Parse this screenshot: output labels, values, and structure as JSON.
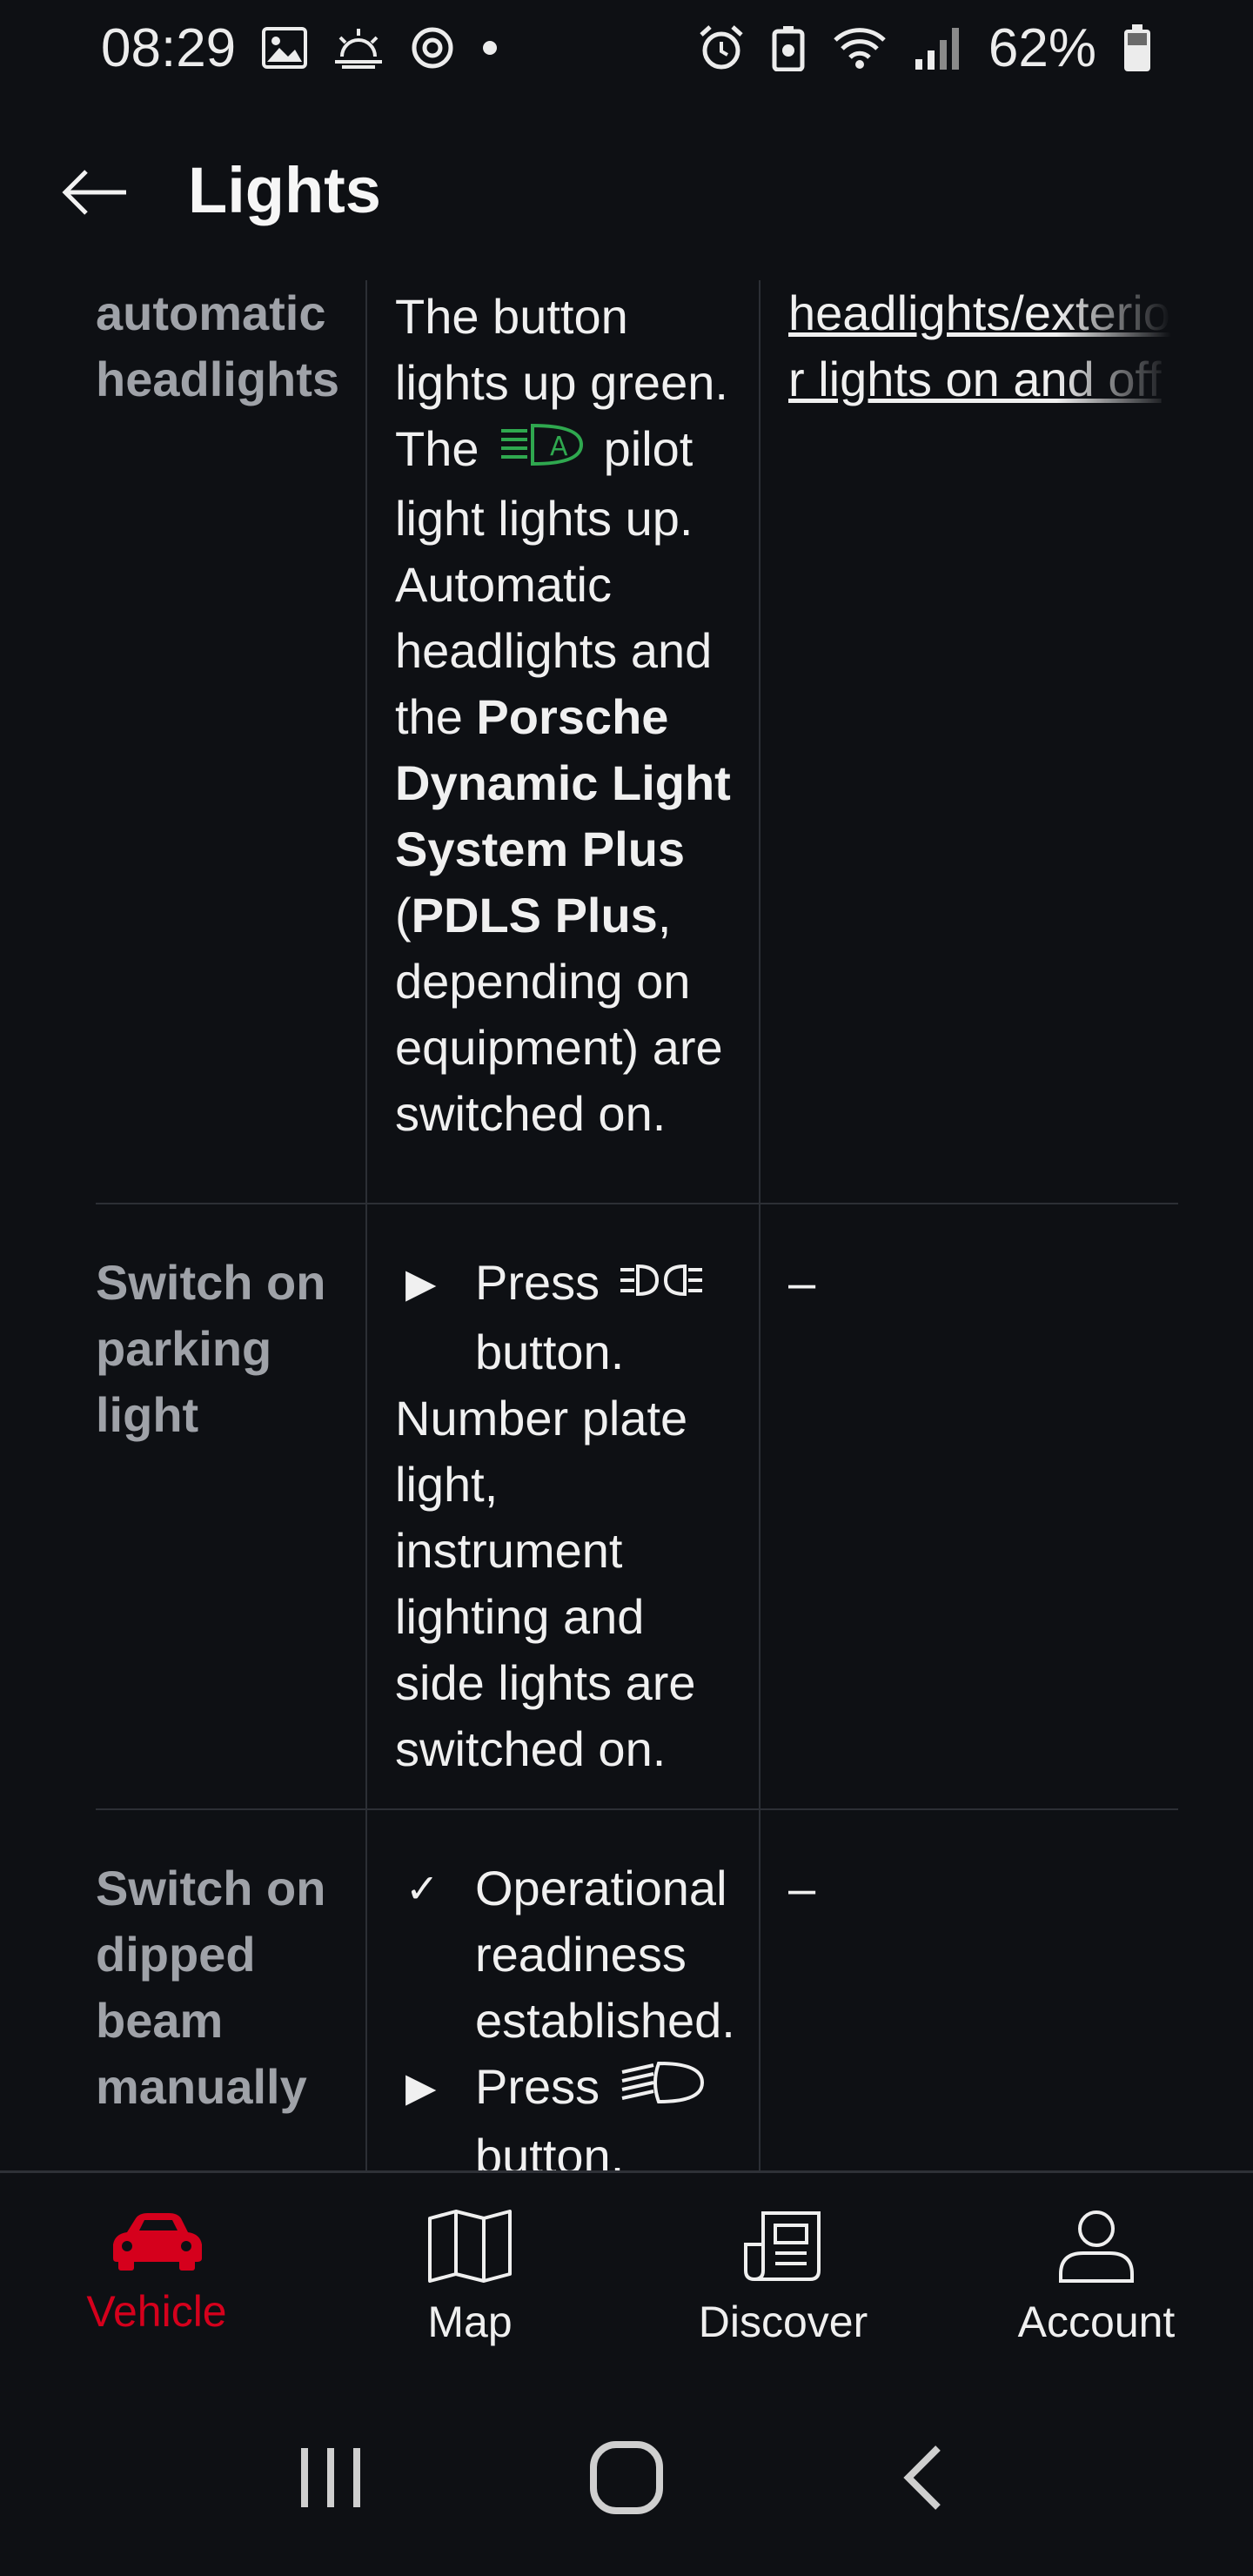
{
  "status_bar": {
    "time": "08:29",
    "battery_percent": "62%",
    "left_icons": [
      "image-icon",
      "weather-icon",
      "sync-icon",
      "dot-icon"
    ],
    "right_icons": [
      "alarm-icon",
      "battery-saver-icon",
      "wifi-icon",
      "signal-icon",
      "battery-icon"
    ]
  },
  "app_bar": {
    "title": "Lights",
    "back_icon": "arrow-left-icon"
  },
  "table": {
    "rows": [
      {
        "action_lines": [
          "automatic",
          "headlights"
        ],
        "result_parts": {
          "p1": "The button lights up green. The",
          "p1_after": "pilot light lights up. Automatic headlights and the",
          "bold1": "Porsche Dynamic Light System Plus",
          "p2": "(",
          "bold2": "PDLS Plus",
          "p3": ", depending on equipment) are switched on."
        },
        "link_lines": [
          "headlights/exterio",
          "r lights on and off"
        ]
      },
      {
        "action_lines": [
          "Switch on",
          "parking",
          "light"
        ],
        "step_marker": "▶",
        "step_text_before": "Press",
        "step_text_after": "button.",
        "result": "Number plate light, instrument lighting and side lights are switched on.",
        "link": "–"
      },
      {
        "action_lines": [
          "Switch on",
          "dipped",
          "beam",
          "manually"
        ],
        "check_marker": "✓",
        "check_text": "Operational readiness established.",
        "step_marker": "▶",
        "step_text_before": "Press",
        "step_text_after": "button.",
        "link": "–"
      }
    ]
  },
  "bottom_nav": {
    "items": [
      {
        "label": "Vehicle",
        "icon": "car-icon",
        "active": true
      },
      {
        "label": "Map",
        "icon": "map-icon",
        "active": false
      },
      {
        "label": "Discover",
        "icon": "news-icon",
        "active": false
      },
      {
        "label": "Account",
        "icon": "person-icon",
        "active": false
      }
    ],
    "active_color": "#d5001c"
  },
  "system_nav": {
    "buttons": [
      "recents-icon",
      "home-icon",
      "back-icon"
    ]
  }
}
